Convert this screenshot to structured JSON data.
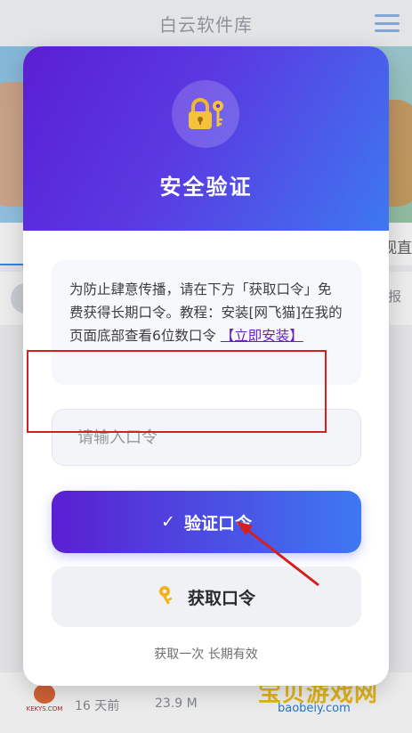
{
  "app": {
    "title": "白云软件库"
  },
  "background": {
    "tab_right_label": "观直",
    "row_right_text": "报",
    "bottom_item": {
      "logo_text": "KEKYS.COM",
      "time": "16 天前",
      "size": "23.9 M"
    },
    "watermark": {
      "text": "宝贝游戏网",
      "url": "baobeiy.com"
    }
  },
  "modal": {
    "title": "安全验证",
    "notice": {
      "text": "为防止肆意传播，请在下方「获取口令」免费获得长期口令。教程：安装[网飞猫]在我的页面底部查看6位数口令 ",
      "link_label": "【立即安装】"
    },
    "input": {
      "value": "",
      "placeholder": "请输入口令"
    },
    "verify_button": {
      "icon": "check-icon",
      "label": "验证口令"
    },
    "get_button": {
      "icon": "key-icon",
      "label": "获取口令"
    },
    "footer_note": "获取一次 长期有效"
  },
  "colors": {
    "brand_gradient_start": "#5a1fd1",
    "brand_gradient_end": "#3e78f2",
    "annotation_red": "#d32020",
    "link_purple": "#6a1fc9"
  }
}
